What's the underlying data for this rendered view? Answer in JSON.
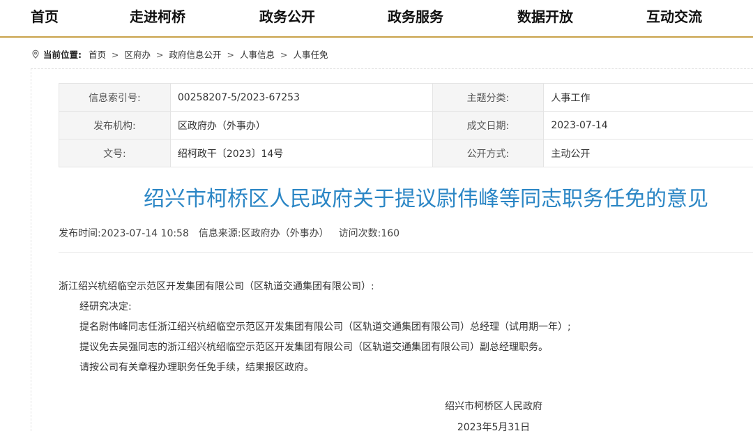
{
  "nav": {
    "items": [
      "首页",
      "走进柯桥",
      "政务公开",
      "政务服务",
      "数据开放",
      "互动交流"
    ]
  },
  "breadcrumb": {
    "label": "当前位置:",
    "items": [
      "首页",
      "区府办",
      "政府信息公开",
      "人事信息",
      "人事任免"
    ],
    "separator": ">"
  },
  "meta": {
    "index_no_label": "信息索引号:",
    "index_no": "00258207-5/2023-67253",
    "topic_label": "主题分类:",
    "topic": "人事工作",
    "org_label": "发布机构:",
    "org": "区政府办（外事办）",
    "date_label": "成文日期:",
    "date": "2023-07-14",
    "docno_label": "文号:",
    "docno": "绍柯政干〔2023〕14号",
    "open_label": "公开方式:",
    "open": "主动公开"
  },
  "article": {
    "title": "绍兴市柯桥区人民政府关于提议尉伟峰等同志职务任免的意见",
    "publish_time_label": "发布时间:",
    "publish_time": "2023-07-14 10:58",
    "source_label": "信息来源:",
    "source": "区政府办（外事办）",
    "visits_label": "访问次数:",
    "visits": "160",
    "recipient": "浙江绍兴杭绍临空示范区开发集团有限公司（区轨道交通集团有限公司）:",
    "paragraphs": [
      "经研究决定:",
      "提名尉伟峰同志任浙江绍兴杭绍临空示范区开发集团有限公司（区轨道交通集团有限公司）总经理（试用期一年）;",
      "提议免去吴强同志的浙江绍兴杭绍临空示范区开发集团有限公司（区轨道交通集团有限公司）副总经理职务。",
      "请按公司有关章程办理职务任免手续，结果报区政府。"
    ],
    "signature_org": "绍兴市柯桥区人民政府",
    "signature_date": "2023年5月31日"
  },
  "colors": {
    "title": "#2b86c5",
    "nav_underline": "#c9a24a"
  }
}
